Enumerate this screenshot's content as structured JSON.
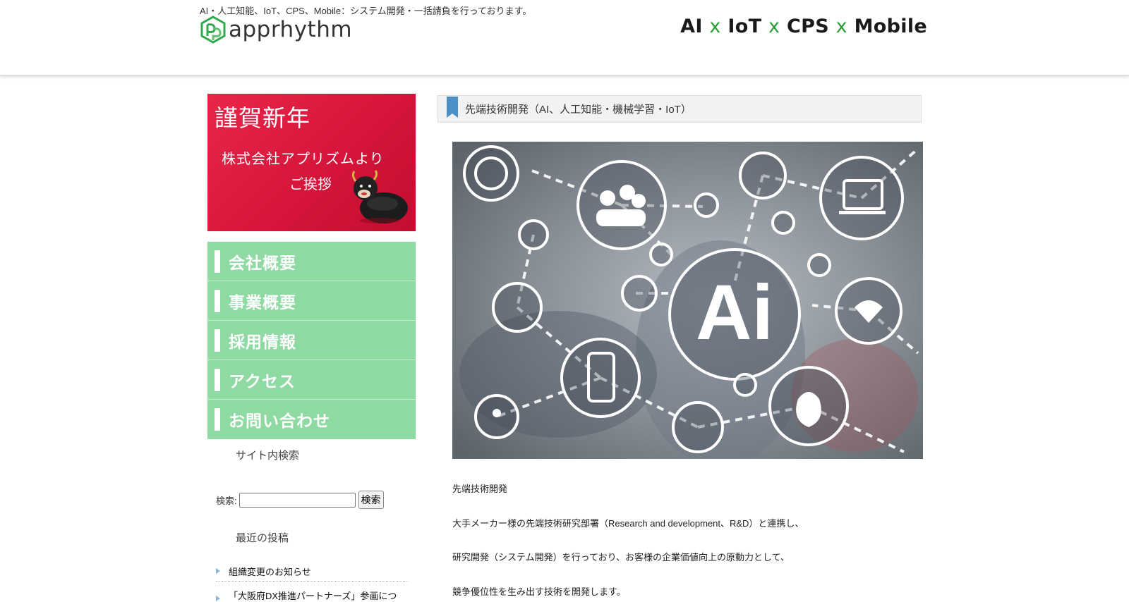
{
  "header": {
    "tagline": "AI・人工知能、IoT、CPS、Mobile：システム開発・一括請負を行っております。",
    "logo_text": "apprhythm",
    "slogan": {
      "p1": "AI",
      "x": "x",
      "p2": "IoT",
      "p3": "CPS",
      "p4": "Mobile"
    }
  },
  "sidebar": {
    "banner": {
      "title": "謹賀新年",
      "line1": "株式会社アプリズムより",
      "line2": "ご挨拶"
    },
    "menu": [
      {
        "label": "会社概要"
      },
      {
        "label": "事業概要"
      },
      {
        "label": "採用情報"
      },
      {
        "label": "アクセス"
      },
      {
        "label": "お問い合わせ"
      }
    ],
    "search": {
      "title": "サイト内検索",
      "label": "検索:",
      "button": "検索",
      "value": ""
    },
    "recent": {
      "title": "最近の投稿",
      "posts": [
        {
          "title": "組織変更のお知らせ"
        },
        {
          "title": "「大阪府DX推進パートナーズ」参画につ"
        }
      ]
    }
  },
  "main": {
    "title": "先端技術開発（AI、人工知能・機械学習・IoT）",
    "hero_center_text": "Ai",
    "paragraphs": [
      "先端技術開発",
      "大手メーカー様の先端技術研究部署（Research and development、R&D）と連携し、",
      "研究開発（システム開発）を行っており、お客様の企業価値向上の原動力として、",
      "競争優位性を生み出す技術を開発します。"
    ]
  },
  "colors": {
    "menu_bg": "#8fd9a3",
    "banner_red": "#d4143a",
    "accent_green": "#2a9d3a"
  }
}
